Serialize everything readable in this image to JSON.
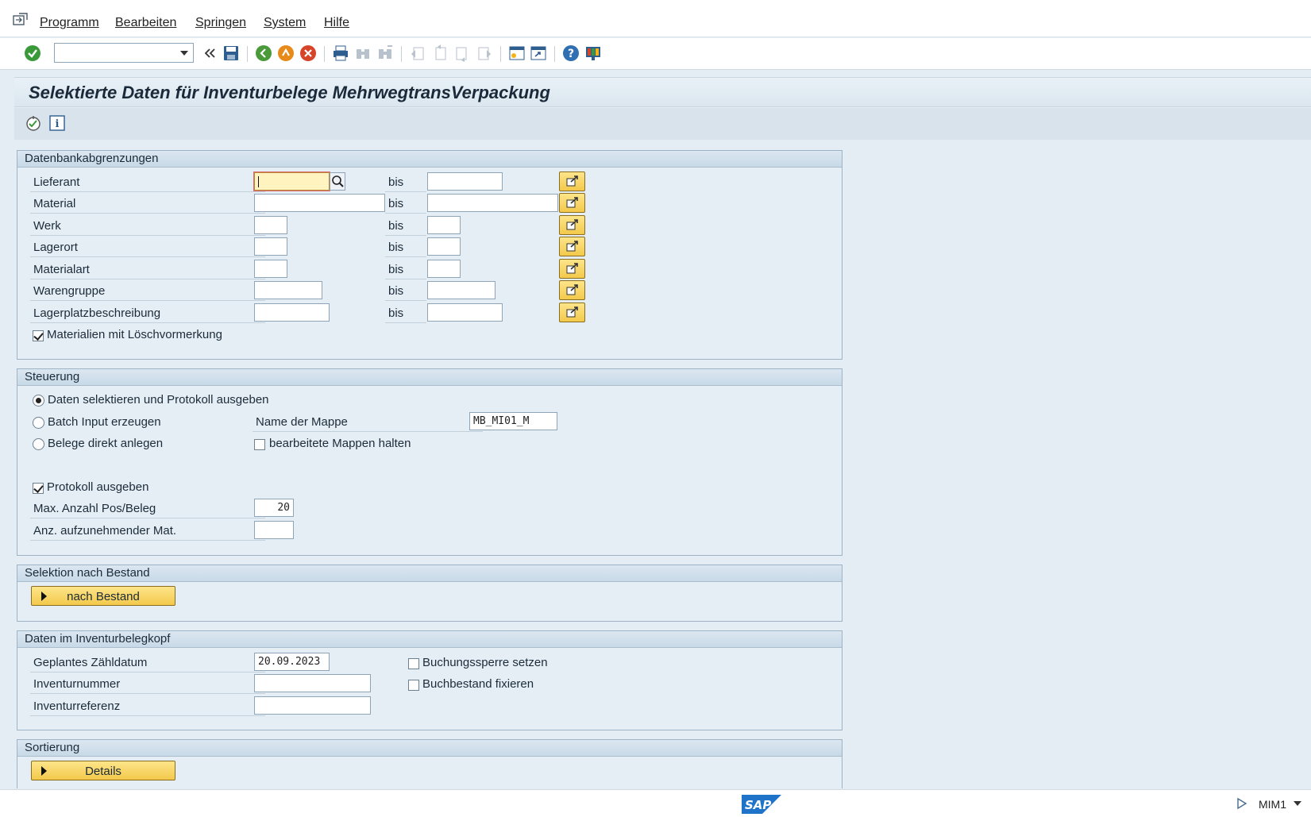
{
  "menu": {
    "items": [
      {
        "label": "Programm"
      },
      {
        "label": "Bearbeiten"
      },
      {
        "label": "Springen"
      },
      {
        "label": "System"
      },
      {
        "label": "Hilfe"
      }
    ]
  },
  "toolbar": {
    "command_field_value": "",
    "icons": [
      "enter-check-icon",
      "back-double-arrow-icon",
      "save-icon",
      "back-icon",
      "exit-icon",
      "cancel-icon",
      "print-icon",
      "find-icon",
      "find-next-icon",
      "first-page-icon",
      "previous-page-icon",
      "next-page-icon",
      "last-page-icon",
      "create-session-icon",
      "shortcut-icon",
      "help-icon",
      "customize-layout-icon"
    ]
  },
  "title": "Selektierte Daten für Inventurbelege MehrwegtransVerpackung",
  "app_toolbar": {
    "icons": [
      "execute-icon",
      "info-icon"
    ]
  },
  "db": {
    "header": "Datenbankabgrenzungen",
    "bis": "bis",
    "rows": [
      {
        "label": "Lieferant",
        "from": "",
        "to": ""
      },
      {
        "label": "Material",
        "from": "",
        "to": ""
      },
      {
        "label": "Werk",
        "from": "",
        "to": ""
      },
      {
        "label": "Lagerort",
        "from": "",
        "to": ""
      },
      {
        "label": "Materialart",
        "from": "",
        "to": ""
      },
      {
        "label": "Warengruppe",
        "from": "",
        "to": ""
      },
      {
        "label": "Lagerplatzbeschreibung",
        "from": "",
        "to": ""
      }
    ],
    "checkbox_label": "Materialien mit Löschvormerkung",
    "checkbox_checked": true
  },
  "steuerung": {
    "header": "Steuerung",
    "radio1": "Daten selektieren und Protokoll ausgeben",
    "radio2": "Batch Input erzeugen",
    "radio3": "Belege direkt anlegen",
    "selected_radio": 1,
    "mappe_label": "Name der Mappe",
    "mappe_value": "MB_MI01_M",
    "halten_label": "bearbeitete Mappen halten",
    "halten_checked": false,
    "protokoll_label": "Protokoll ausgeben",
    "protokoll_checked": true,
    "maxpos_label": "Max. Anzahl Pos/Beleg",
    "maxpos_value": "20",
    "anz_label": "Anz. aufzunehmender Mat.",
    "anz_value": ""
  },
  "bestand": {
    "header": "Selektion nach Bestand",
    "button": "nach Bestand"
  },
  "kopf": {
    "header": "Daten im Inventurbelegkopf",
    "datum_label": "Geplantes Zähldatum",
    "datum_value": "20.09.2023",
    "invnr_label": "Inventurnummer",
    "invnr_value": "",
    "invref_label": "Inventurreferenz",
    "invref_value": "",
    "sperre_label": "Buchungssperre setzen",
    "sperre_checked": false,
    "fix_label": "Buchbestand fixieren",
    "fix_checked": false
  },
  "sortierung": {
    "header": "Sortierung",
    "button": "Details"
  },
  "status": {
    "logo": "SAP",
    "tcode": "MIM1"
  }
}
